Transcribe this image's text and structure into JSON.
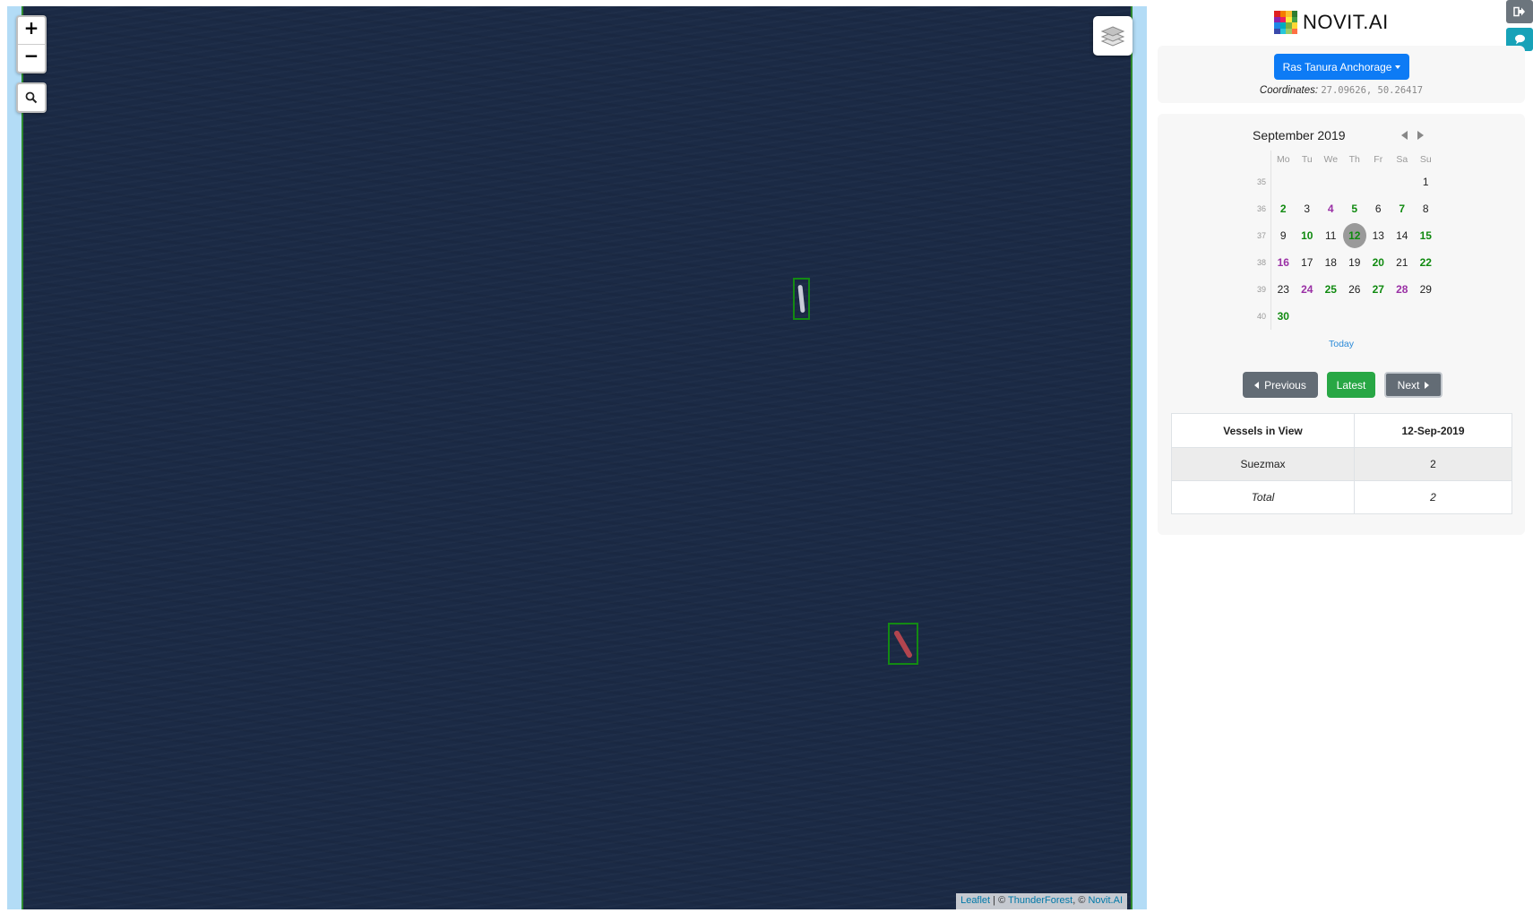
{
  "map": {
    "zoom_in": "+",
    "zoom_out": "−",
    "attribution": {
      "leaflet": "Leaflet",
      "sep": " | © ",
      "thunderforest": "ThunderForest",
      "sep2": ", © ",
      "novit": "Novit.AI"
    },
    "icons": [
      "search-icon",
      "layers-icon"
    ]
  },
  "header": {
    "brand": "NOVIT.AI",
    "logo_colors": [
      "#e02020",
      "#f57c00",
      "#fbc02d",
      "#2e7d32",
      "#8e24aa",
      "#e91e63",
      "#ffeb3b",
      "#43a047",
      "#1e88e5",
      "#00acc1",
      "#7cb342",
      "#fdd835",
      "#3949ab",
      "#26c6da",
      "#9ccc65",
      "#ff7043"
    ],
    "logout_color": "#6c757d",
    "chat_color": "#17a2b8"
  },
  "location": {
    "selected": "Ras Tanura Anchorage",
    "coordinates_label": "Coordinates:",
    "coordinates_value": "27.09626, 50.26417",
    "button_color": "#0d7bf5"
  },
  "calendar": {
    "title": "September 2019",
    "weekdays": [
      "Mo",
      "Tu",
      "We",
      "Th",
      "Fr",
      "Sa",
      "Su"
    ],
    "weeks": [
      {
        "wk": "35",
        "days": [
          {
            "d": ""
          },
          {
            "d": ""
          },
          {
            "d": ""
          },
          {
            "d": ""
          },
          {
            "d": ""
          },
          {
            "d": ""
          },
          {
            "d": "1"
          }
        ]
      },
      {
        "wk": "36",
        "days": [
          {
            "d": "2",
            "s": "green"
          },
          {
            "d": "3"
          },
          {
            "d": "4",
            "s": "purple"
          },
          {
            "d": "5",
            "s": "green"
          },
          {
            "d": "6"
          },
          {
            "d": "7",
            "s": "green"
          },
          {
            "d": "8"
          }
        ]
      },
      {
        "wk": "37",
        "days": [
          {
            "d": "9"
          },
          {
            "d": "10",
            "s": "green"
          },
          {
            "d": "11"
          },
          {
            "d": "12",
            "s": "green selected"
          },
          {
            "d": "13"
          },
          {
            "d": "14"
          },
          {
            "d": "15",
            "s": "green"
          }
        ]
      },
      {
        "wk": "38",
        "days": [
          {
            "d": "16",
            "s": "purple"
          },
          {
            "d": "17"
          },
          {
            "d": "18"
          },
          {
            "d": "19"
          },
          {
            "d": "20",
            "s": "green"
          },
          {
            "d": "21"
          },
          {
            "d": "22",
            "s": "green"
          }
        ]
      },
      {
        "wk": "39",
        "days": [
          {
            "d": "23"
          },
          {
            "d": "24",
            "s": "purple"
          },
          {
            "d": "25",
            "s": "green"
          },
          {
            "d": "26"
          },
          {
            "d": "27",
            "s": "green"
          },
          {
            "d": "28",
            "s": "purple"
          },
          {
            "d": "29"
          }
        ]
      },
      {
        "wk": "40",
        "days": [
          {
            "d": "30",
            "s": "green"
          },
          {
            "d": ""
          },
          {
            "d": ""
          },
          {
            "d": ""
          },
          {
            "d": ""
          },
          {
            "d": ""
          },
          {
            "d": ""
          }
        ]
      }
    ],
    "today": "Today",
    "colors": {
      "green": "#108a10",
      "purple": "#9a30a5"
    }
  },
  "nav": {
    "previous": "Previous",
    "latest": "Latest",
    "next": "Next"
  },
  "table": {
    "col1": "Vessels in View",
    "col2": "12-Sep-2019",
    "rows": [
      {
        "type": "Suezmax",
        "count": "2"
      }
    ],
    "total_label": "Total",
    "total_value": "2"
  }
}
